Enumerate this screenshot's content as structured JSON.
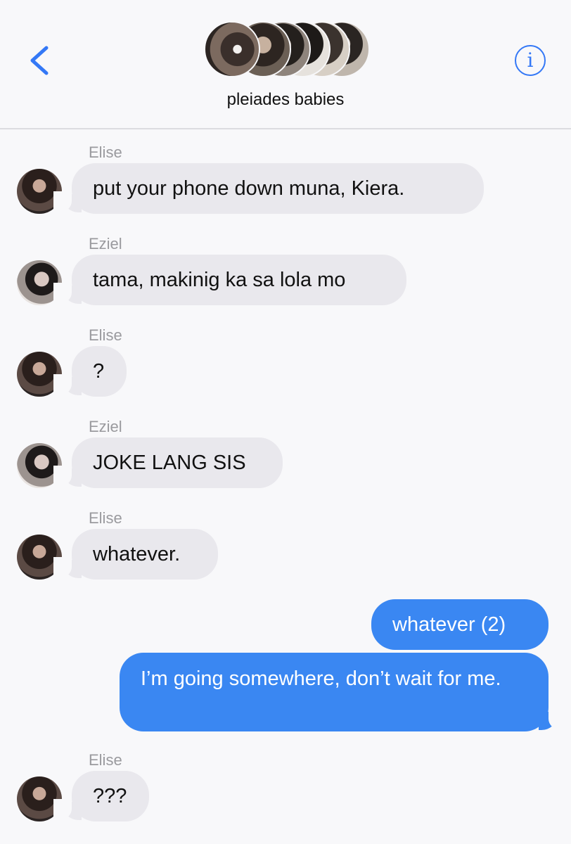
{
  "header": {
    "group_name": "pleiades babies",
    "back_icon": "chevron-left-icon",
    "info_icon": "info-icon",
    "info_glyph": "i",
    "accent_color": "#3478f6"
  },
  "messages": [
    {
      "sender": "Elise",
      "text": "put your phone down muna, Kiera.",
      "direction": "incoming"
    },
    {
      "sender": "Eziel",
      "text": "tama, makinig ka sa lola mo",
      "direction": "incoming"
    },
    {
      "sender": "Elise",
      "text": "?",
      "direction": "incoming"
    },
    {
      "sender": "Eziel",
      "text": "JOKE LANG SIS",
      "direction": "incoming"
    },
    {
      "sender": "Elise",
      "text": "whatever.",
      "direction": "incoming"
    },
    {
      "text": "whatever (2)",
      "direction": "outgoing"
    },
    {
      "text": "I’m going somewhere, don’t wait for me.",
      "direction": "outgoing"
    },
    {
      "sender": "Elise",
      "text": "???",
      "direction": "incoming"
    }
  ],
  "colors": {
    "incoming_bubble": "#e9e8ed",
    "outgoing_bubble": "#3a87f2",
    "sender_label": "#9a9a9e",
    "background": "#f8f8fa"
  }
}
